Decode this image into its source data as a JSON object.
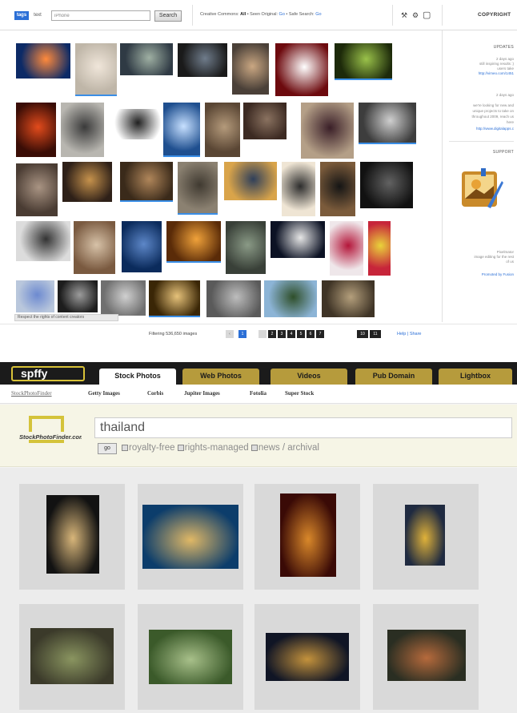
{
  "top_screenshot": {
    "toolbar": {
      "tab_tags": "tags",
      "tab_text": "text",
      "search_value": "iPhone",
      "search_button": "Search",
      "filter_creative_commons": "Creative Commons:",
      "filter_creative_commons_value": "All",
      "filter_seen_original": "• Seen Original:",
      "filter_seen_original_value": "Go",
      "filter_safe_search": "• Safe Search:",
      "filter_safe_search_value": "Go",
      "copyright_label": "COPYRIGHT"
    },
    "right_panel": {
      "updates_heading": "UPDATES",
      "support_heading": "SUPPORT",
      "update1_time": "2 days ago",
      "update1_text1": "still inspiring results :)",
      "update1_text2": "users take",
      "update1_link": "http://vimeo.com/1451",
      "update2_time": "2 days ago",
      "update2_text1": "we're looking for new and",
      "update2_text2": "unique projects to take on",
      "update2_text3": "throughout 2009, reach us",
      "update2_text4": "here",
      "update2_link": "http://www.digitalapps.c",
      "app_name": "Pixelmator",
      "app_desc1": "image editing for the rest",
      "app_desc2": "of us",
      "app_link": "Promoted by Fusion"
    },
    "tooltip": "Respect the rights of content creators",
    "pager": {
      "filter_count": "Filtering 536,650 images",
      "pages": [
        "1",
        "2",
        "3",
        "4",
        "5",
        "6",
        "7"
      ],
      "next_a": "10",
      "next_b": "11",
      "help": "Help",
      "sep": "|",
      "share": "Share"
    },
    "thumbnail_colors": [
      [
        "#0c2a66",
        "#ff8a3c"
      ],
      [
        "#bfb6a8",
        "#f0e6da"
      ],
      [
        "#2f3a44",
        "#9fb0a3"
      ],
      [
        "#1a1a1a",
        "#6f7c8b"
      ],
      [
        "#4a4038",
        "#caa782"
      ],
      [
        "#6d0a0e",
        "#ffffff"
      ],
      [
        "#1d2a0a",
        "#9ac24a"
      ],
      [
        "#3a0d06",
        "#e24b1c"
      ],
      [
        "#b8b6b0",
        "#3a3a3a"
      ],
      [
        "#ffffff",
        "#202020"
      ],
      [
        "#1f4f8f",
        "#c7e0ff"
      ],
      [
        "#5a4634",
        "#b49a7b"
      ],
      [
        "#3c2a22",
        "#8a7260"
      ],
      [
        "#b49f87",
        "#3a1f28"
      ],
      [
        "#3d3d3d",
        "#cfcfcf"
      ],
      [
        "#4a3c33",
        "#a99483"
      ],
      [
        "#2e2018",
        "#c6924c"
      ],
      [
        "#3a2a1a",
        "#b0865a"
      ],
      [
        "#8b8171",
        "#403a31"
      ],
      [
        "#d9a44a",
        "#2f3f5a"
      ],
      [
        "#efe5d4",
        "#2d2d2d"
      ],
      [
        "#7b5b3b",
        "#151515"
      ],
      [
        "#111111",
        "#626262"
      ],
      [
        "#dcdcdc",
        "#333333"
      ],
      [
        "#7a5a40",
        "#d7c2a8"
      ],
      [
        "#0b2b5c",
        "#5d87c8"
      ],
      [
        "#5a2b08",
        "#f0a23a"
      ],
      [
        "#394038",
        "#8a9a86"
      ],
      [
        "#0c1224",
        "#e6e6e6"
      ],
      [
        "#efe7ea",
        "#b4163a"
      ],
      [
        "#c7253a",
        "#e9d33a"
      ],
      [
        "#b9c7dc",
        "#6d8ad0"
      ],
      [
        "#1d1d1d",
        "#9c9c9c"
      ],
      [
        "#6f6f6f",
        "#d0d0d0"
      ],
      [
        "#3a2606",
        "#e6c27a"
      ],
      [
        "#5a5a5a",
        "#bdbdbd"
      ],
      [
        "#8cb4d6",
        "#2f4f2a"
      ],
      [
        "#3f3426",
        "#b49f7c"
      ]
    ]
  },
  "bottom_screenshot": {
    "logo_text": "spffy",
    "nav_tabs": [
      "Stock Photos",
      "Web Photos",
      "Videos",
      "Pub Domain",
      "Lightbox"
    ],
    "sub_nav": [
      "StockPhotoFinder",
      "Getty Images",
      "Corbis",
      "Jupiter Images",
      "Fotolia",
      "Super Stock"
    ],
    "logo_caption": "StockPhotoFinder.com",
    "query": "thailand",
    "go_label": "go",
    "filters": [
      "royalty-free",
      "rights-managed",
      "news / archival"
    ],
    "result_tiles": [
      [
        "#121212",
        "#d8b67a"
      ],
      [
        "#0c3d6b",
        "#e0b866"
      ],
      [
        "#3a0a06",
        "#d9882a"
      ],
      [
        "#1f2a40",
        "#e0b23a"
      ],
      [
        "#3b3a2a",
        "#8a9560"
      ],
      [
        "#3b5a2a",
        "#a8c08a"
      ],
      [
        "#101525",
        "#c4923c"
      ],
      [
        "#2a2e22",
        "#b66a3c"
      ]
    ]
  }
}
